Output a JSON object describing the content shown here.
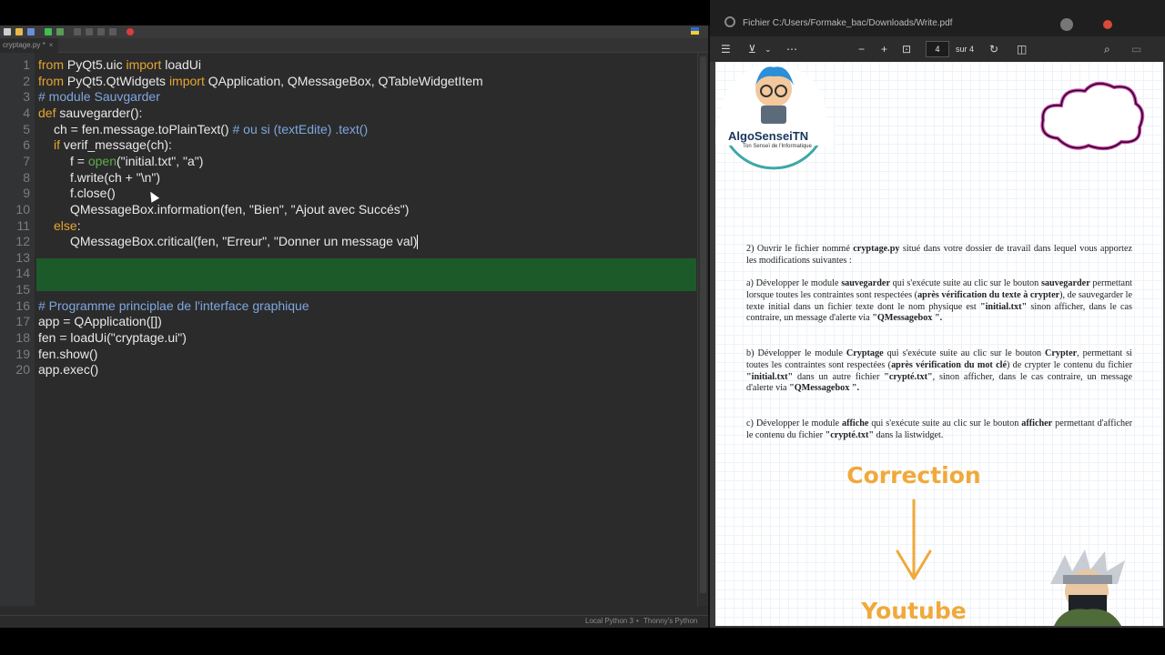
{
  "ide": {
    "tab_label": "cryptage.py *",
    "tab_close": "×",
    "status_interpreter": "Local Python 3",
    "status_separator": "•",
    "status_app": "Thonny's Python",
    "line_numbers": [
      "1",
      "2",
      "3",
      "4",
      "5",
      "6",
      "7",
      "8",
      "9",
      "10",
      "11",
      "12",
      "13",
      "14",
      "15",
      "16",
      "17",
      "18",
      "19",
      "20"
    ],
    "code": {
      "l1_kw1": "from",
      "l1_mod": " PyQt5.uic ",
      "l1_kw2": "import",
      "l1_rest": " loadUi",
      "l2_kw1": "from",
      "l2_mod": " PyQt5.QtWidgets ",
      "l2_kw2": "import",
      "l2_rest": " QApplication, QMessageBox, QTableWidgetItem",
      "l3_comment": "# module Sauvgarder",
      "l4_kw": "def",
      "l4_rest": " sauvegarder():",
      "l5_code": "ch = fen.message.toPlainText() ",
      "l5_comment": "# ou si (textEdite) .text()",
      "l6_kw": "if",
      "l6_rest": " verif_message(ch):",
      "l7_a": "f = ",
      "l7_builtin": "open",
      "l7_b": "(\"initial.txt\", \"a\")",
      "l8": "f.write(ch + \"\\n\")",
      "l9": "f.close()",
      "l10": "QMessageBox.information(fen, \"Bien\", \"Ajout avec Succés\")",
      "l11_kw": "else",
      "l11_rest": ":",
      "l12": "QMessageBox.critical(fen, \"Erreur\", \"Donner un message val)",
      "l16_comment": "# Programme principlae de l'interface graphique",
      "l17": "app = QApplication([])",
      "l18": "fen = loadUi(\"cryptage.ui\")",
      "l19": "fen.show()",
      "l20": "app.exec()"
    }
  },
  "pdf": {
    "address": "Fichier   C:/Users/Formake_bac/Downloads/Write.pdf",
    "current_page": "4",
    "page_count": "sur 4",
    "logo_brand": "AlgoSenseiTN",
    "logo_subtitle": "Ton Senseï de l'Informatique",
    "intro": {
      "a": "2) Ouvrir le fichier nommé ",
      "b": "cryptage.py",
      "c": " situé dans votre dossier de travail dans lequel vous apportez les modifications suivantes :"
    },
    "item_a": {
      "a": "a) Développer le module ",
      "b": "sauvegarder",
      "c": " qui s'exécute suite au clic sur le bouton ",
      "d": "sauvegarder",
      "e": " permettant lorsque toutes les contraintes sont respectées (",
      "f": "après vérification du texte à crypter",
      "g": "), de sauvegarder le texte initial dans un fichier texte dont le nom physique est ",
      "h": "\"initial.txt\"",
      "i": " sinon afficher, dans le cas        contraire, un message d'alerte via ",
      "j": "\"QMessagebox \"."
    },
    "item_b": {
      "a": "b) Développer le module ",
      "b": "Cryptage",
      "c": " qui s'exécute suite au clic sur le bouton ",
      "d": "Crypter",
      "e": ", permettant si toutes les contraintes sont respectées (",
      "f": "après vérification du mot clé",
      "g": ") de crypter le contenu du fichier ",
      "h": "\"initial.txt\"",
      "i": " dans un autre fichier ",
      "j": "\"crypté.txt\"",
      "k": ", sinon afficher, dans le cas contraire, un message d'alerte via ",
      "l": "\"QMessagebox \"."
    },
    "item_c": {
      "a": "c) Développer le module ",
      "b": "affiche",
      "c": " qui s'exécute suite au clic sur le bouton ",
      "d": "afficher",
      "e": " permettant d'afficher le contenu du fichier ",
      "f": "\"crypté.txt\"",
      "g": " dans la listwidget."
    },
    "overlay_correction": "Correction",
    "overlay_youtube": "Youtube"
  },
  "colors": {
    "keyword": "#e6a532",
    "comment": "#7ea7e0",
    "builtin": "#5dac4b",
    "highlight": "#1d5a2a",
    "accent_orange": "#f0a93a"
  },
  "icons": [
    "run-icon",
    "debug-icon",
    "stop-icon",
    "menu-icon",
    "annotate-icon",
    "more-icon",
    "zoom-out-icon",
    "zoom-in-icon",
    "fit-page-icon",
    "rotate-icon",
    "two-page-icon",
    "search-icon",
    "save-icon",
    "down-arrow-icon",
    "cloud-icon",
    "mascot-icon",
    "ninja-icon"
  ]
}
